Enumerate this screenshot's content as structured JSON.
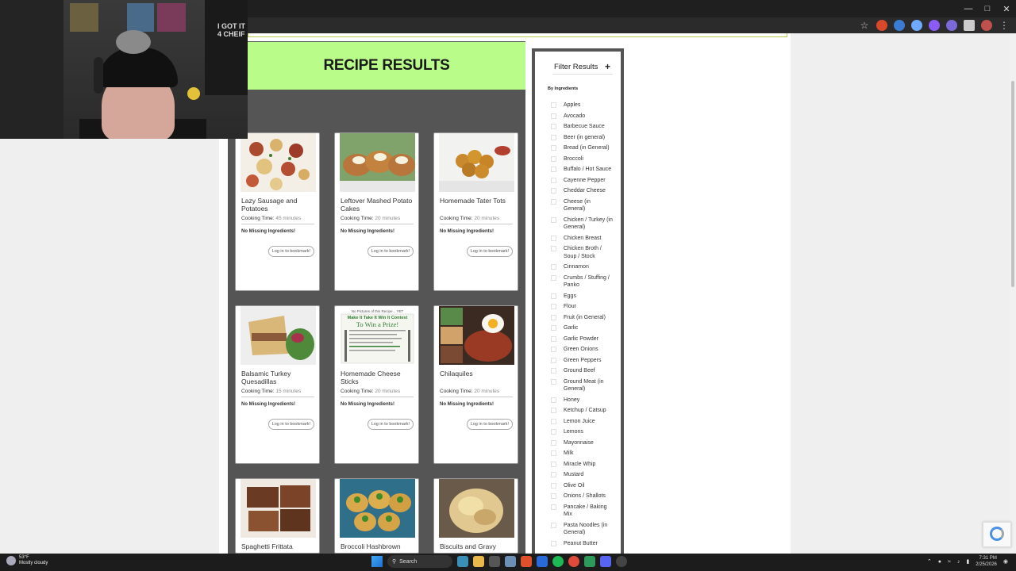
{
  "page": {
    "results_title": "RECIPE RESULTS"
  },
  "labels": {
    "cooking_time": "Cooking Time:",
    "no_missing": "No Missing Ingredients!",
    "bookmark": "Log in to bookmark!"
  },
  "recipes": [
    {
      "title": "Lazy Sausage and Potatoes",
      "time": "45 minutes"
    },
    {
      "title": "Leftover Mashed Potato Cakes",
      "time": "20 minutes"
    },
    {
      "title": "Homemade Tater Tots",
      "time": "20 minutes"
    },
    {
      "title": "Balsamic Turkey Quesadillas",
      "time": "15 minutes"
    },
    {
      "title": "Homemade Cheese Sticks",
      "time": "20 minutes"
    },
    {
      "title": "Chilaquiles",
      "time": "20 minutes"
    },
    {
      "title": "Spaghetti Frittata",
      "time": ""
    },
    {
      "title": "Broccoli Hashbrown",
      "time": ""
    },
    {
      "title": "Biscuits and Gravy",
      "time": ""
    }
  ],
  "image_caption": {
    "line1": "No Pictures of this Recipe... YET",
    "line2": "Make It Take It Win It Contest",
    "line3": "To Win a Prize!"
  },
  "filter": {
    "title": "Filter Results",
    "plus": "+",
    "subheading": "By Ingredients",
    "ingredients": [
      "Apples",
      "Avocado",
      "Barbecue Sauce",
      "Beer (in general)",
      "Bread (in General)",
      "Broccoli",
      "Buffalo / Hot Sauce",
      "Cayenne Pepper",
      "Cheddar Cheese",
      "Cheese (in General)",
      "Chicken / Turkey (in General)",
      "Chicken Breast",
      "Chicken Broth / Soup / Stock",
      "Cinnamon",
      "Crumbs / Stuffing / Panko",
      "Eggs",
      "Flour",
      "Fruit (in General)",
      "Garlic",
      "Garlic Powder",
      "Green Onions",
      "Green Peppers",
      "Ground Beef",
      "Ground Meat (in General)",
      "Honey",
      "Ketchup / Catsup",
      "Lemon Juice",
      "Lemons",
      "Mayonnaise",
      "Milk",
      "Miracle Whip",
      "Mustard",
      "Olive Oil",
      "Onions / Shallots",
      "Pancake / Baking Mix",
      "Pasta Noodles (in General)",
      "Peanut Butter"
    ]
  },
  "webcam": {
    "poster_text": "I GOT IT 4 CHEIF"
  },
  "taskbar": {
    "temp": "53°F",
    "weather": "Mostly cloudy",
    "search": "Search",
    "time": "7:31 PM",
    "date": "2/25/2026"
  },
  "colors": {
    "header_green": "#b9fc8a",
    "panel_gray": "#555555",
    "accent_line": "#b8c94a"
  }
}
